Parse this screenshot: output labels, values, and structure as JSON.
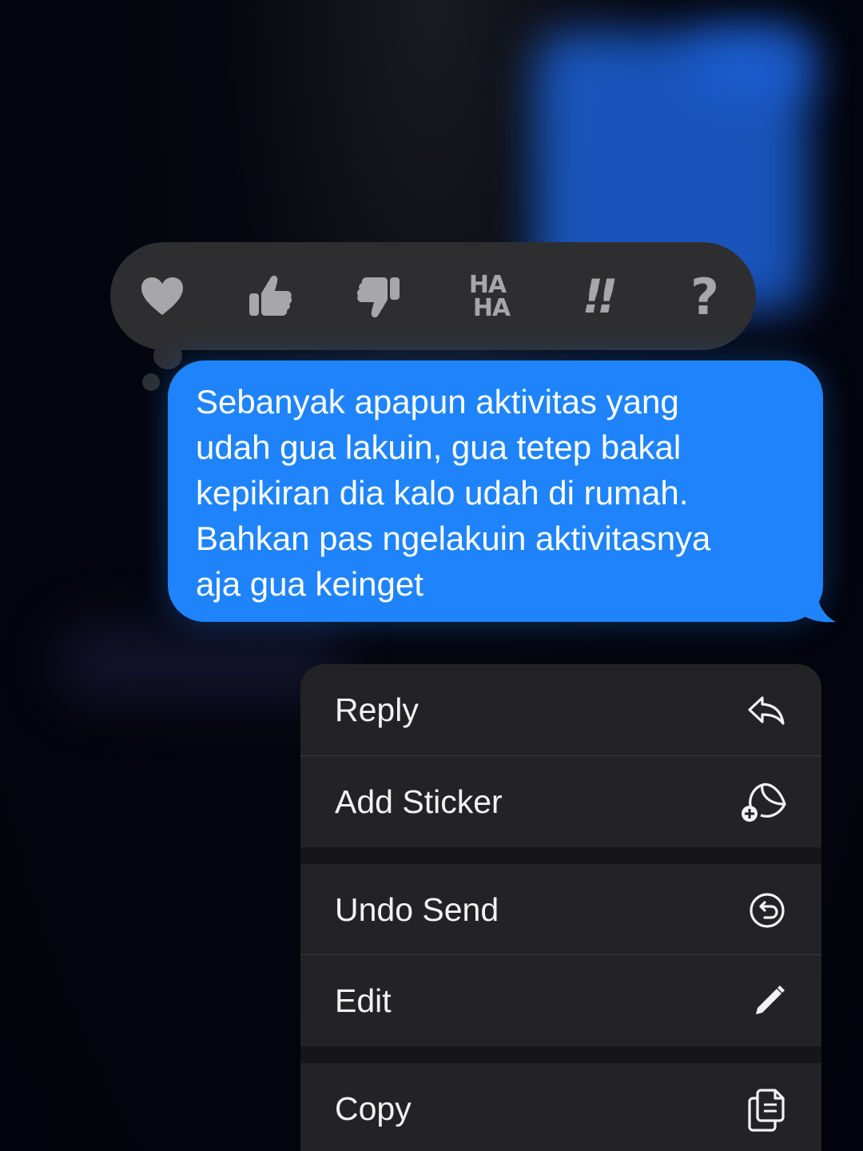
{
  "reactions": [
    {
      "name": "heart"
    },
    {
      "name": "thumbs-up"
    },
    {
      "name": "thumbs-down"
    },
    {
      "name": "haha",
      "text_top": "HA",
      "text_bottom": "HA"
    },
    {
      "name": "exclamation",
      "text": "!!"
    },
    {
      "name": "question",
      "text": "?"
    }
  ],
  "message": {
    "lines": [
      "Sebanyak apapun aktivitas yang",
      "udah gua lakuin, gua tetep bakal",
      "kepikiran dia kalo udah di rumah.",
      "Bahkan pas ngelakuin aktivitasnya",
      "aja gua keinget"
    ],
    "bubble_color": "#1f84fb",
    "text_color": "#ffffff"
  },
  "menu": {
    "items": [
      {
        "label": "Reply",
        "icon": "reply-icon"
      },
      {
        "label": "Add Sticker",
        "icon": "sticker-add-icon"
      },
      {
        "label": "Undo Send",
        "icon": "undo-send-icon"
      },
      {
        "label": "Edit",
        "icon": "pencil-icon"
      },
      {
        "label": "Copy",
        "icon": "copy-icon"
      }
    ]
  },
  "colors": {
    "background": "#03040e",
    "tapback_bg": "#2e2e31",
    "reaction_icon": "#a6a6ab",
    "menu_bg": "#232326",
    "menu_text": "#f2f2f4"
  }
}
